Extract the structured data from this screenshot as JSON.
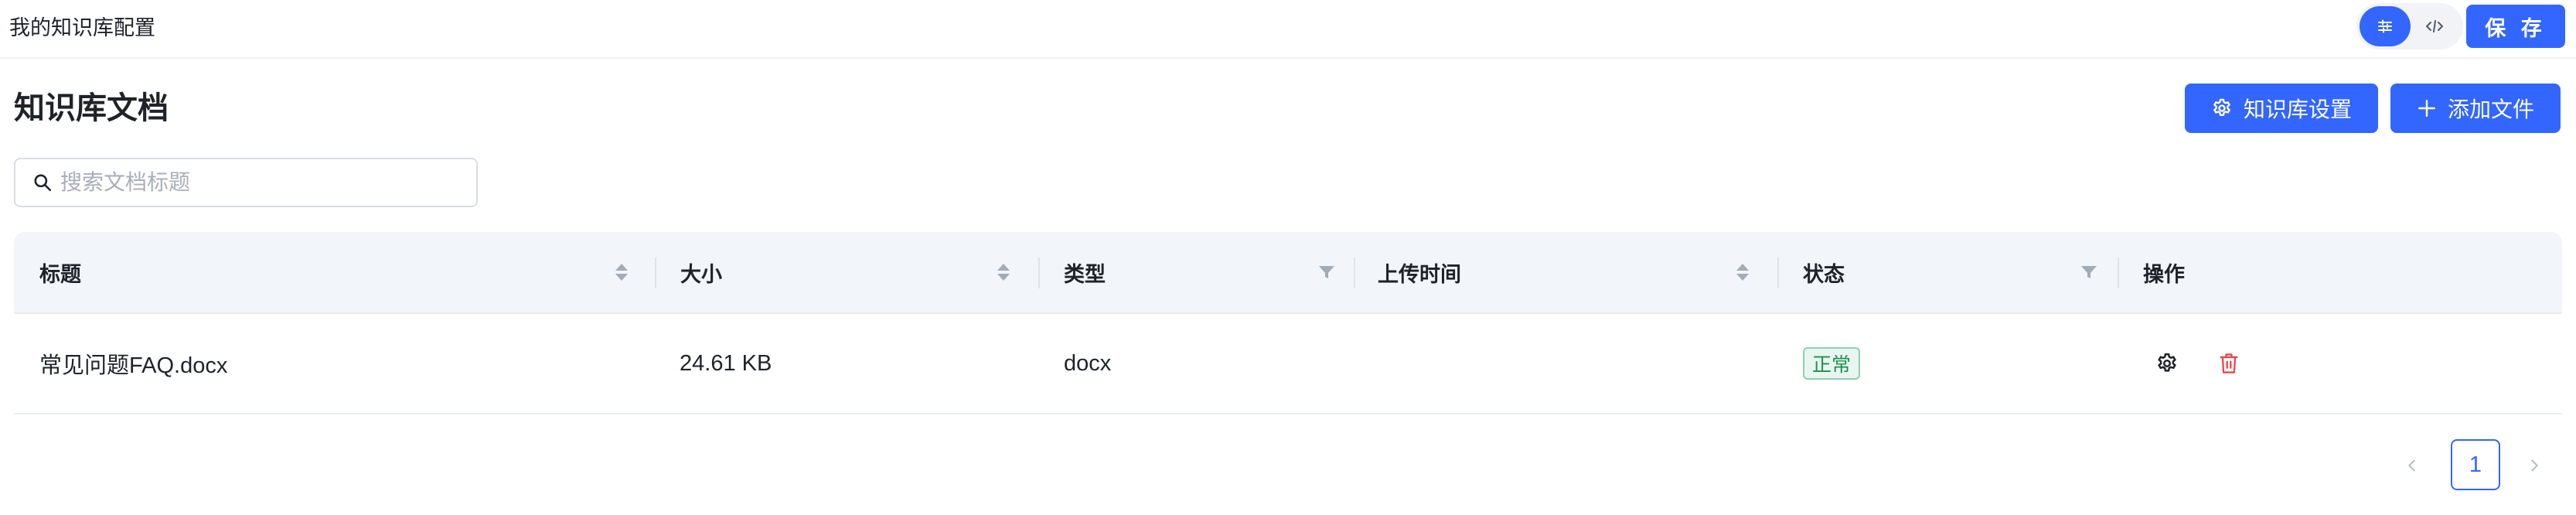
{
  "app": {
    "title": "我的知识库配置"
  },
  "toolbar": {
    "save_label": "保 存",
    "mode_visual_icon": "sliders-icon",
    "mode_code_icon": "code-icon"
  },
  "section": {
    "title": "知识库文档",
    "kb_settings_label": "知识库设置",
    "add_file_label": "添加文件"
  },
  "search": {
    "placeholder": "搜索文档标题",
    "value": ""
  },
  "table": {
    "columns": [
      {
        "label": "标题",
        "control": "sort"
      },
      {
        "label": "大小",
        "control": "sort"
      },
      {
        "label": "类型",
        "control": "filter"
      },
      {
        "label": "上传时间",
        "control": "sort"
      },
      {
        "label": "状态",
        "control": "filter"
      },
      {
        "label": "操作",
        "control": "none"
      }
    ],
    "rows": [
      {
        "title": "常见问题FAQ.docx",
        "size": "24.61 KB",
        "type": "docx",
        "uploaded": "",
        "status": "正常"
      }
    ]
  },
  "pagination": {
    "current_page": "1"
  },
  "colors": {
    "primary": "#3366ff",
    "status_ok": "#1f8f52",
    "danger": "#e5484d"
  }
}
